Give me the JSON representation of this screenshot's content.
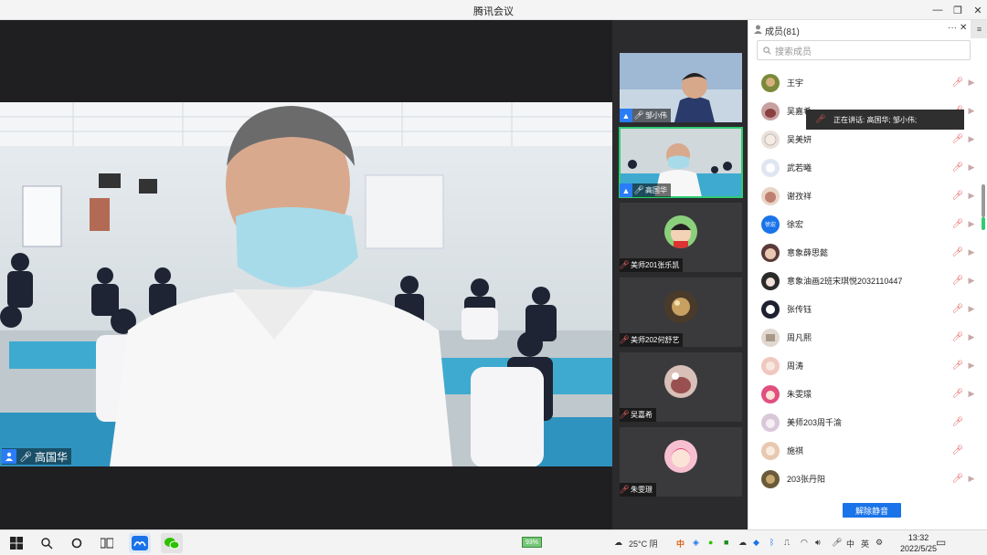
{
  "window": {
    "title": "腾讯会议",
    "minimize": "—",
    "maximize": "❐",
    "close": "✕"
  },
  "main_video": {
    "speaker_name": "高国华"
  },
  "thumbnails": [
    {
      "name": "邹小伟",
      "host": true
    },
    {
      "name": "高国华",
      "host": true,
      "active": true
    },
    {
      "name": "美师201张乐凯",
      "host": false
    },
    {
      "name": "美师202何舒艺",
      "host": false
    },
    {
      "name": "吴嘉希",
      "host": false
    },
    {
      "name": "朱雯璟",
      "host": false
    }
  ],
  "members_panel": {
    "title": "成员(81)",
    "more_label": "···",
    "close_label": "✕",
    "search_placeholder": "搜索成员",
    "speaking_tooltip": "正在讲话: 高国华; 邹小伟;",
    "unmute_all_label": "解除静音",
    "members": [
      {
        "name": "王宇",
        "avatar_color": "#7a8a3a"
      },
      {
        "name": "吴嘉希",
        "avatar_color": "#c8a0a0"
      },
      {
        "name": "吴美妍",
        "avatar_color": "#e8d8d0"
      },
      {
        "name": "武若曦",
        "avatar_color": "#dfe6f2"
      },
      {
        "name": "谢孜祥",
        "avatar_color": "#e8d5c8"
      },
      {
        "name": "徐宏",
        "avatar_color": "#1a73e8",
        "initials": "徐宏"
      },
      {
        "name": "意象薛思懿",
        "avatar_color": "#5a3a3a"
      },
      {
        "name": "意象油画2班宋琪悦2032110447",
        "avatar_color": "#2a2a2a"
      },
      {
        "name": "张传钰",
        "avatar_color": "#1e2030"
      },
      {
        "name": "周凡熙",
        "avatar_color": "#e0d8d0"
      },
      {
        "name": "周涛",
        "avatar_color": "#f0c8c0"
      },
      {
        "name": "朱雯璟",
        "avatar_color": "#e05080"
      },
      {
        "name": "美师203周千渝",
        "avatar_color": "#d8c8d8"
      },
      {
        "name": "施祺",
        "avatar_color": "#e8c8b0"
      },
      {
        "name": "203张丹阳",
        "avatar_color": "#6a5a3a"
      }
    ]
  },
  "taskbar": {
    "battery": "93%",
    "weather": "25°C 阴",
    "ime": "中",
    "ime2": "英",
    "time": "13:32",
    "date": "2022/5/25"
  },
  "colors": {
    "accent": "#1a73e8",
    "muted": "#e05a5a",
    "active_border": "#2ecc71"
  }
}
